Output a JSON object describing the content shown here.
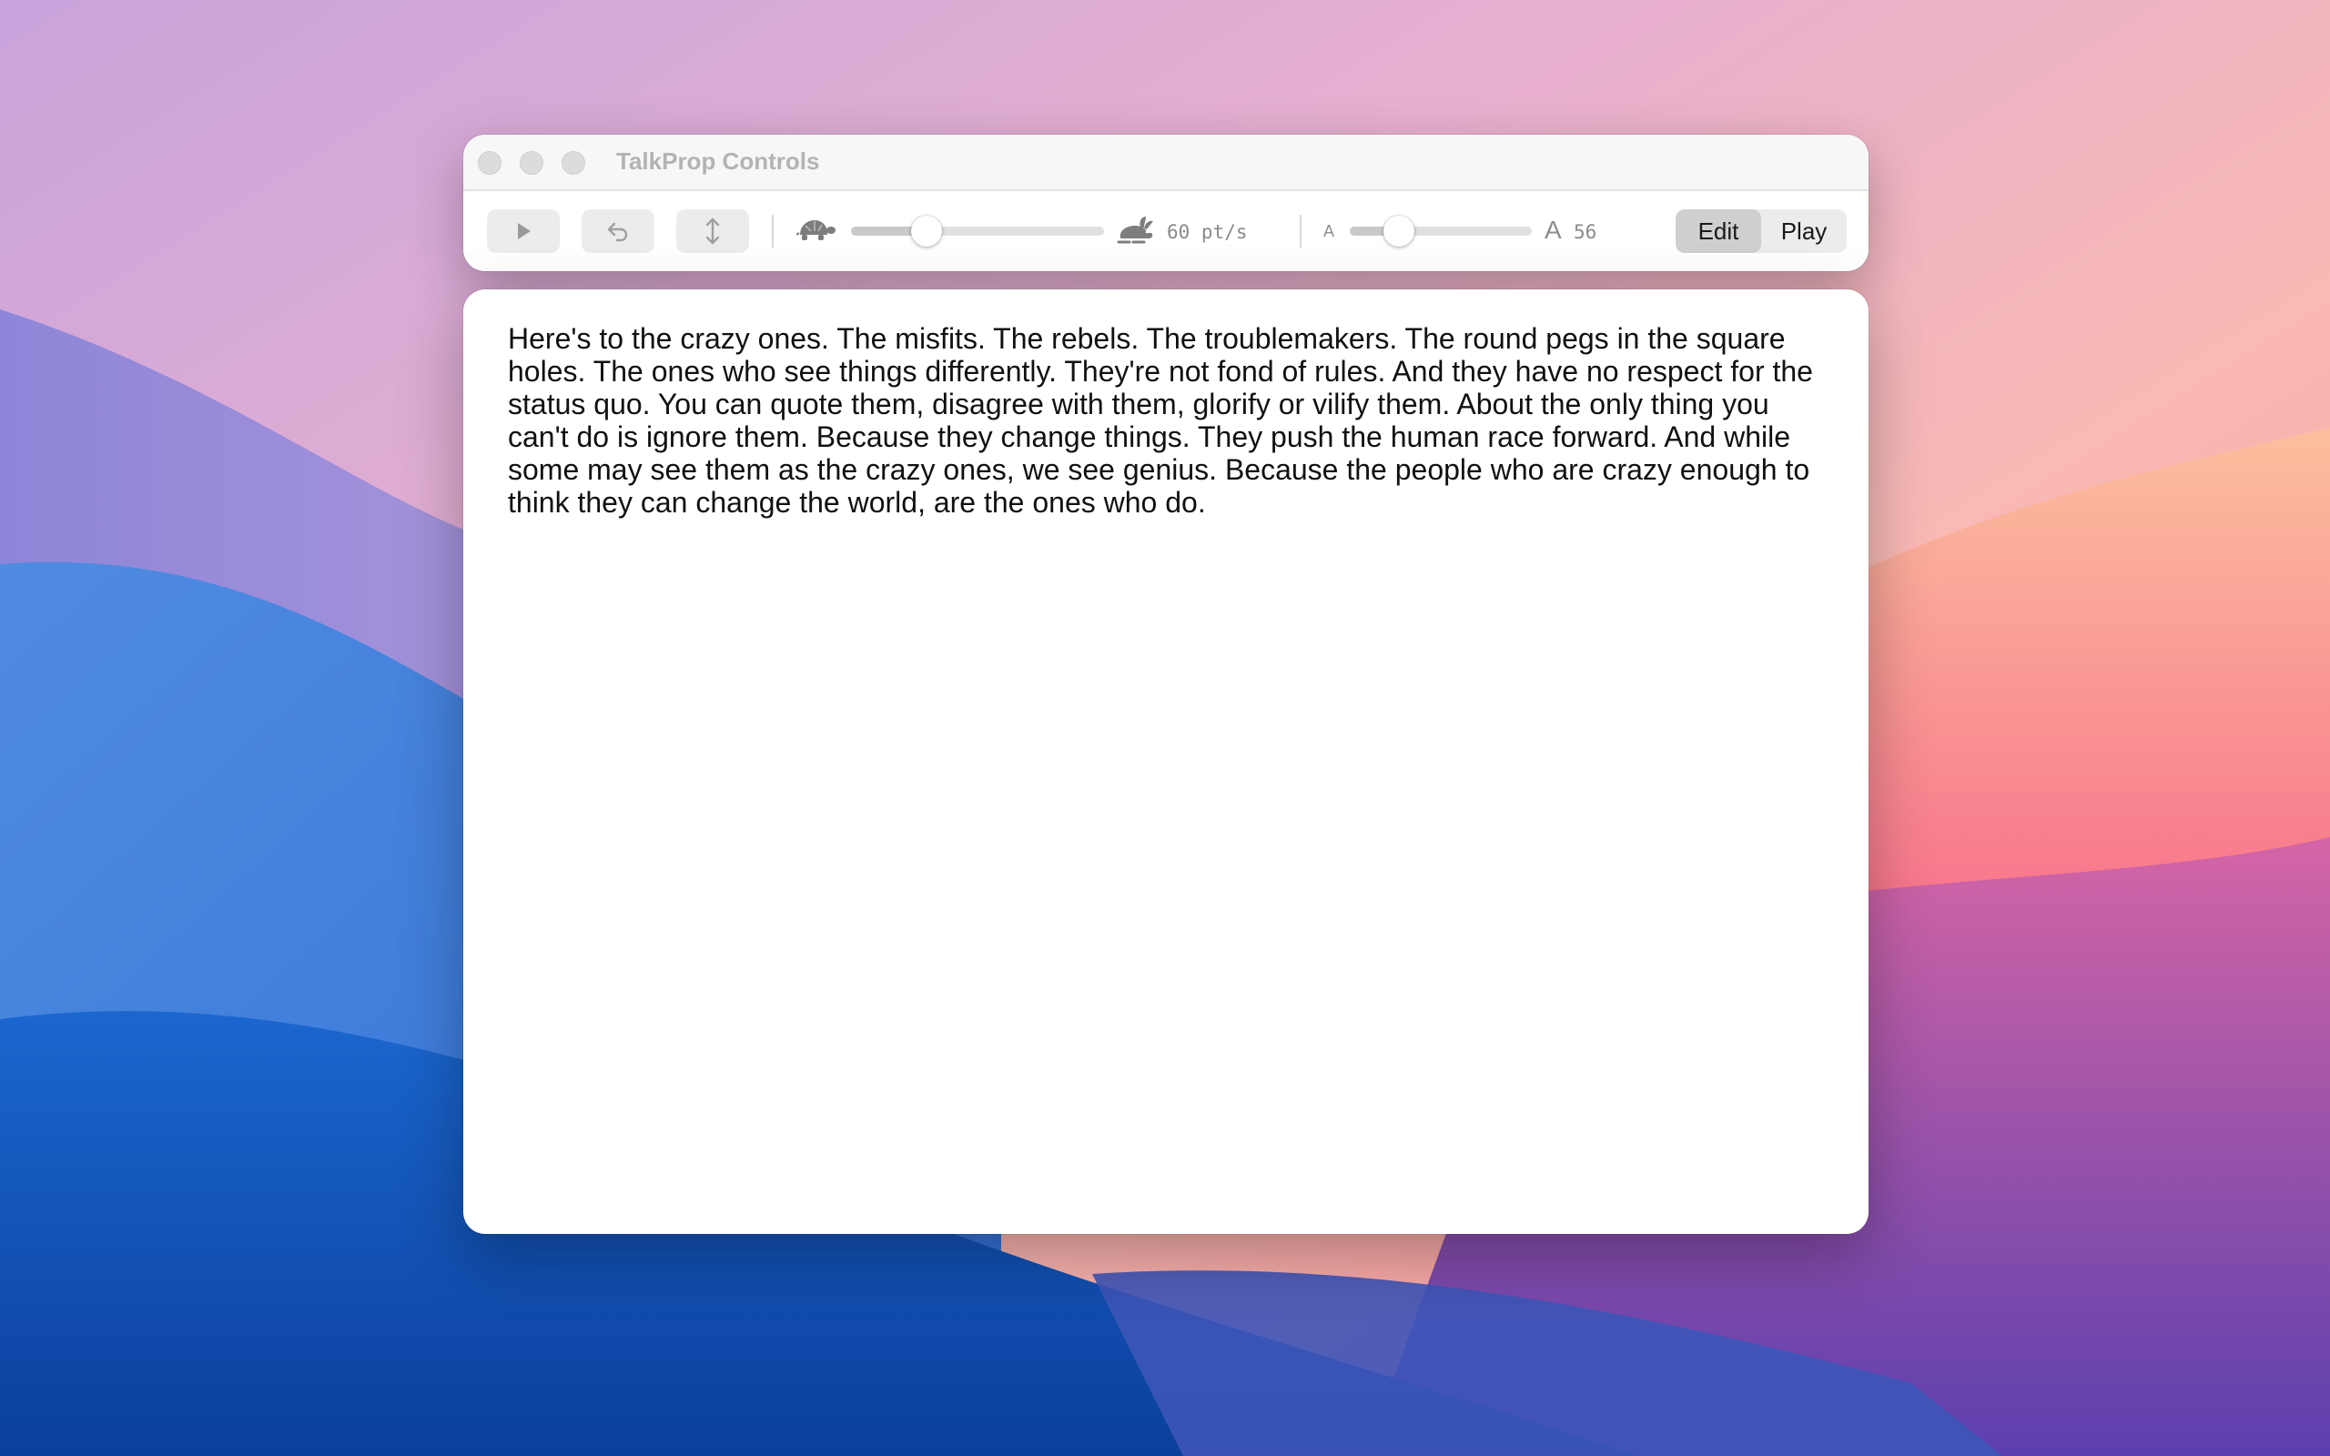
{
  "window": {
    "title": "TalkProp Controls"
  },
  "toolbar": {
    "play_icon": "play-icon",
    "undo_icon": "undo-arrow-icon",
    "reposition_icon": "vertical-arrows-icon",
    "speed": {
      "slow_icon": "tortoise-icon",
      "fast_icon": "hare-icon",
      "value_fraction": 0.3,
      "readout": "60 pt/s"
    },
    "font_size": {
      "small_label": "A",
      "large_label": "A",
      "value_fraction": 0.27,
      "readout": "56"
    },
    "mode": {
      "edit_label": "Edit",
      "play_label": "Play",
      "selected": "Edit"
    }
  },
  "editor": {
    "text": "Here's to the crazy ones. The misfits. The rebels. The troublemakers. The round pegs in the square holes. The ones who see things differently. They're not fond of rules. And they have no respect for the status quo. You can quote them, disagree with them, glorify or vilify them. About the only thing you can't do is ignore them. Because they change things. They push the human race forward. And while some may see them as the crazy ones, we see genius. Because the people who are crazy enough to think they can change the world, are the ones who do."
  }
}
